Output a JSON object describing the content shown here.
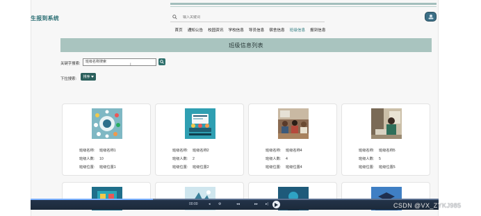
{
  "brand": "生报到系统",
  "search": {
    "placeholder": "输入关键词"
  },
  "nav": [
    {
      "label": "首页"
    },
    {
      "label": "通知公告"
    },
    {
      "label": "校园资讯"
    },
    {
      "label": "学校信息"
    },
    {
      "label": "导员信息"
    },
    {
      "label": "宿舍信息"
    },
    {
      "label": "班级信息"
    },
    {
      "label": "报到信息"
    }
  ],
  "page_title": "班级信息列表",
  "filters": {
    "keyword_label": "关键字搜索:",
    "keyword_value": "班级名称搜索",
    "dropdown_label": "下拉搜索:",
    "sort_label": "排序"
  },
  "field_labels": {
    "name": "班级名称:",
    "count": "班级人数:",
    "location": "班级位置:"
  },
  "cards": [
    {
      "name": "班级名称1",
      "count": "10",
      "location": "班级位置1",
      "thumb": "infographic-icon"
    },
    {
      "name": "班级名称2",
      "count": "2",
      "location": "班级位置2",
      "thumb": "classroom-illustration"
    },
    {
      "name": "班级名称4",
      "count": "4",
      "location": "班级位置4",
      "thumb": "classroom-photo"
    },
    {
      "name": "班级名称5",
      "count": "5",
      "location": "班级位置5",
      "thumb": "student-photo"
    }
  ],
  "player": {
    "time": "00:00"
  },
  "watermark": "CSDN @VX_ZYKJ985",
  "colors": {
    "accent": "#2d6f6b",
    "band": "#a9c4bf",
    "active_nav": "#2d7a7e"
  }
}
